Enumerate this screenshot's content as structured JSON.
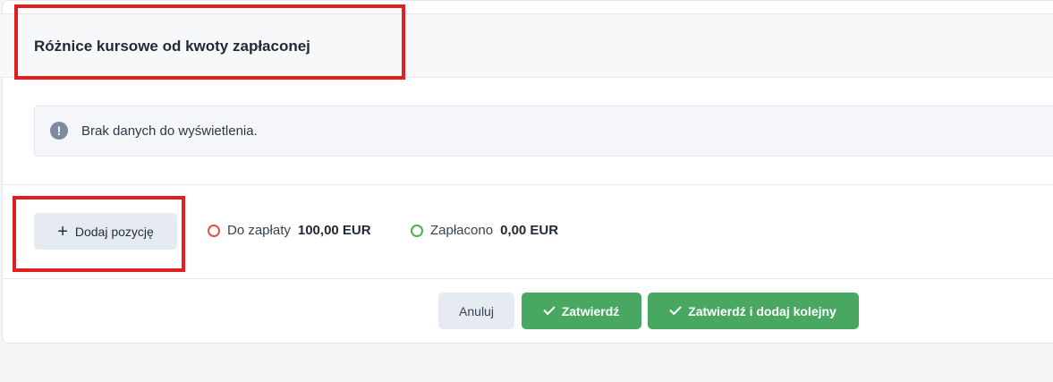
{
  "section": {
    "title": "Różnice kursowe od kwoty zapłaconej"
  },
  "info": {
    "message": "Brak danych do wyświetlenia.",
    "icon": "exclamation-icon"
  },
  "actions_row": {
    "add_label": "Dodaj pozycję",
    "add_icon": "plus-icon"
  },
  "summary": {
    "due": {
      "label": "Do zapłaty",
      "value": "100,00 EUR",
      "color": "#d9534f"
    },
    "paid": {
      "label": "Zapłacono",
      "value": "0,00 EUR",
      "color": "#4caf50"
    }
  },
  "footer": {
    "cancel_label": "Anuluj",
    "confirm_label": "Zatwierdź",
    "confirm_add_label": "Zatwierdź i dodaj kolejny"
  },
  "highlight_color": "#e02020"
}
